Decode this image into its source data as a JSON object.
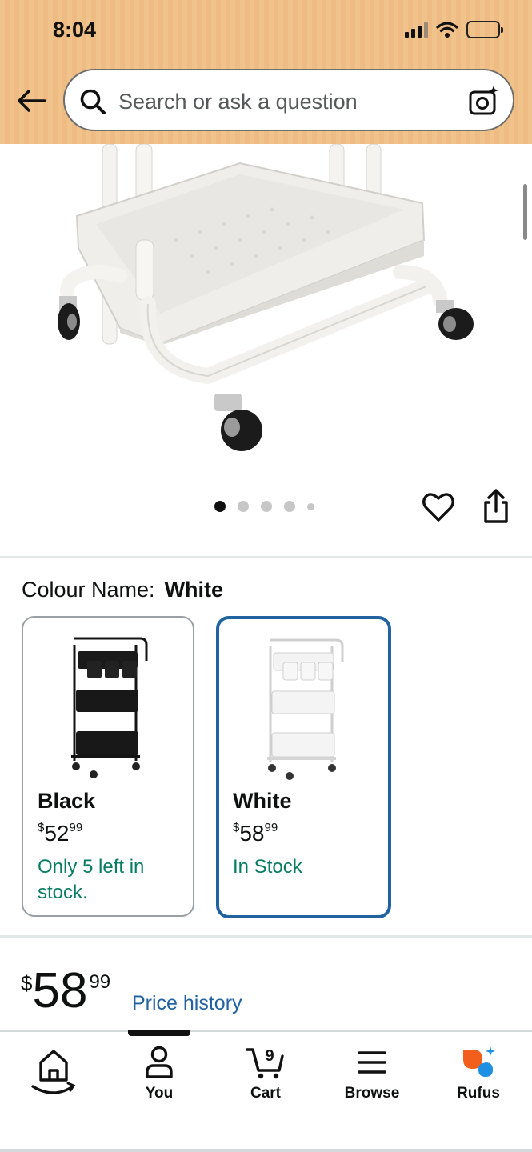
{
  "status_bar": {
    "time": "8:04"
  },
  "header": {
    "search_placeholder": "Search or ask a question"
  },
  "image_carousel": {
    "total_images": 5,
    "active_index": 0
  },
  "variation": {
    "label": "Colour Name:",
    "selected": "White",
    "options": [
      {
        "name": "Black",
        "price_symbol": "$",
        "price_whole": "52",
        "price_fraction": "99",
        "availability": "Only 5 left in stock."
      },
      {
        "name": "White",
        "price_symbol": "$",
        "price_whole": "58",
        "price_fraction": "99",
        "availability": "In Stock"
      }
    ]
  },
  "price": {
    "symbol": "$",
    "whole": "58",
    "fraction": "99",
    "history_link": "Price history"
  },
  "bottom_nav": {
    "items": [
      {
        "label": "",
        "icon": "home-icon"
      },
      {
        "label": "You",
        "icon": "person-icon"
      },
      {
        "label": "Cart",
        "icon": "cart-icon",
        "badge": "9"
      },
      {
        "label": "Browse",
        "icon": "menu-icon"
      },
      {
        "label": "Rufus",
        "icon": "rufus-icon"
      }
    ]
  },
  "colors": {
    "header_bg": "#f1c38c",
    "link": "#2162a1",
    "in_stock": "#067d62",
    "selected_border": "#2162a1"
  }
}
